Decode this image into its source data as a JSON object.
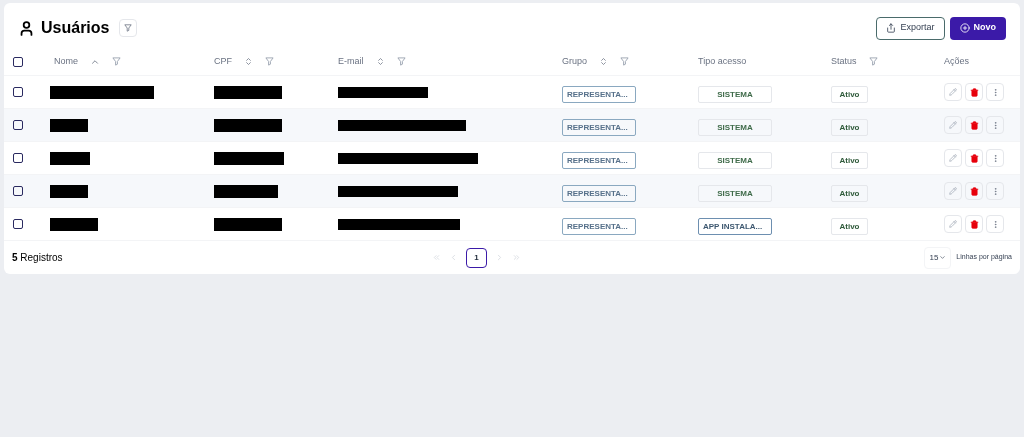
{
  "title": "Usuários",
  "actions": [
    {
      "kind": "outline",
      "label": "Exportar"
    },
    {
      "kind": "primary",
      "label": "Novo"
    }
  ],
  "select_all_checked": false,
  "columns": [
    {
      "label": "Nome",
      "sortable": true,
      "sorted": true,
      "filter": true
    },
    {
      "label": "CPF",
      "sortable": true,
      "sorted": false,
      "filter": true
    },
    {
      "label": "E-mail",
      "sortable": true,
      "sorted": false,
      "filter": true
    },
    {
      "label": "Grupo",
      "sortable": true,
      "sorted": false,
      "filter": true
    },
    {
      "label": "Tipo acesso",
      "sortable": false,
      "filter": false
    },
    {
      "label": "Status",
      "sortable": false,
      "filter": true
    },
    {
      "label": "Ações",
      "sortable": false,
      "filter": false
    }
  ],
  "rows": [
    {
      "checked": false,
      "grupo": "REPRESENTA...",
      "tipo": {
        "kind": "system",
        "label": "SISTEMA"
      },
      "status": "Ativo"
    },
    {
      "checked": false,
      "grupo": "REPRESENTA...",
      "tipo": {
        "kind": "system",
        "label": "SISTEMA"
      },
      "status": "Ativo"
    },
    {
      "checked": false,
      "grupo": "REPRESENTA...",
      "tipo": {
        "kind": "system",
        "label": "SISTEMA"
      },
      "status": "Ativo"
    },
    {
      "checked": false,
      "grupo": "REPRESENTA...",
      "tipo": {
        "kind": "system",
        "label": "SISTEMA"
      },
      "status": "Ativo"
    },
    {
      "checked": false,
      "grupo": "REPRESENTA...",
      "tipo": {
        "kind": "app",
        "label": "APP INSTALA..."
      },
      "status": "Ativo"
    }
  ],
  "footer": {
    "count": "**5** Registros",
    "pages": [
      {
        "label": "1",
        "selected": true
      }
    ],
    "page_size": "15",
    "page_size_label": "Linhas por página"
  }
}
